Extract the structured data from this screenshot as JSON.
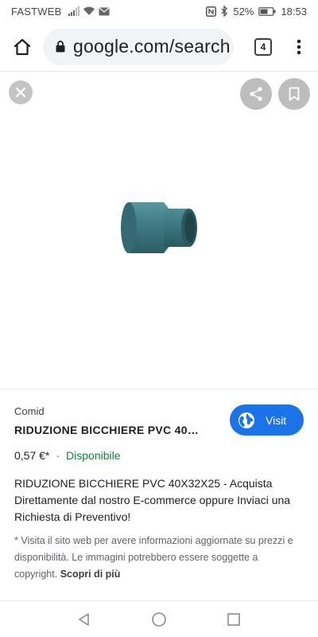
{
  "status_bar": {
    "carrier": "FASTWEB",
    "battery": "52%",
    "time": "18:53",
    "icons_left": [
      "signal-icon",
      "wifi-icon",
      "message-icon"
    ],
    "icons_right": [
      "nfc-icon",
      "bluetooth-icon",
      "battery-icon"
    ]
  },
  "browser": {
    "url": "google.com/search",
    "tab_count": "4"
  },
  "viewer": {
    "image_alt": "PVC reducer fitting",
    "image_color": "#3f7b83"
  },
  "product": {
    "source": "Comid",
    "title": "RIDUZIONE BICCHIERE PVC 40…",
    "price": "0,57 €*",
    "separator": "·",
    "availability": "Disponibile",
    "visit_label": "Visit",
    "description": "RIDUZIONE BICCHIERE PVC 40X32X25 - Acquista Direttamente dal nostro E-commerce oppure Inviaci una Richiesta di Preventivo!",
    "disclaimer": "* Visita il sito web per avere informazioni aggiornate su prezzi e disponibilità. Le immagini potrebbero essere soggette a copyright.",
    "learn_more": "Scopri di più"
  },
  "colors": {
    "accent": "#1a73e8",
    "available": "#188038",
    "viewer_button": "#bdbdbd"
  }
}
